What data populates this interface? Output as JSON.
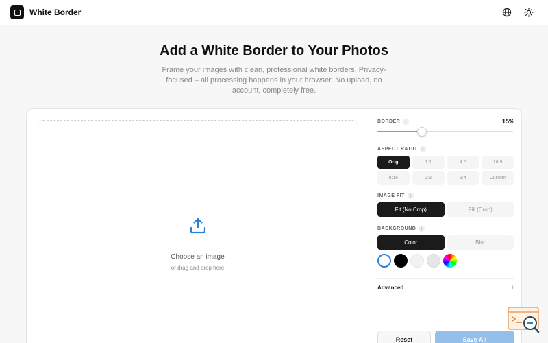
{
  "app": {
    "title": "White Border"
  },
  "header": {
    "language_icon": "globe-icon",
    "theme_icon": "sun-icon"
  },
  "hero": {
    "title": "Add a White Border to Your Photos",
    "subtitle": "Frame your images with clean, professional white borders. Privacy-focused – all processing happens in your browser. No upload, no account, completely free."
  },
  "dropzone": {
    "title": "Choose an image",
    "subtitle": "or drag and drop here",
    "icon": "upload-icon"
  },
  "panel": {
    "border": {
      "label": "BORDER",
      "value": 15,
      "value_text": "15%",
      "max": 100
    },
    "aspect_ratio": {
      "label": "ASPECT RATIO",
      "options": [
        "Orig",
        "1:1",
        "4:5",
        "16:9",
        "9:16",
        "2:3",
        "3:4",
        "Custom"
      ],
      "selected": "Orig"
    },
    "image_fit": {
      "label": "IMAGE FIT",
      "options": [
        "Fit (No Crop)",
        "Fill (Crop)"
      ],
      "selected": "Fit (No Crop)"
    },
    "background": {
      "label": "BACKGROUND",
      "options": [
        "Color",
        "Blur"
      ],
      "selected": "Color",
      "swatches": [
        "#ffffff",
        "#000000",
        "#f2f2f2",
        "#e6e6e6",
        "rainbow"
      ],
      "selected_swatch": "#ffffff"
    },
    "advanced": {
      "label": "Advanced",
      "toggle": "+"
    },
    "actions": {
      "reset": "Reset",
      "save": "Save All"
    }
  },
  "colors": {
    "accent": "#2b7fd6",
    "dark": "#1b1b1b",
    "save_disabled": "#93bfe9"
  }
}
